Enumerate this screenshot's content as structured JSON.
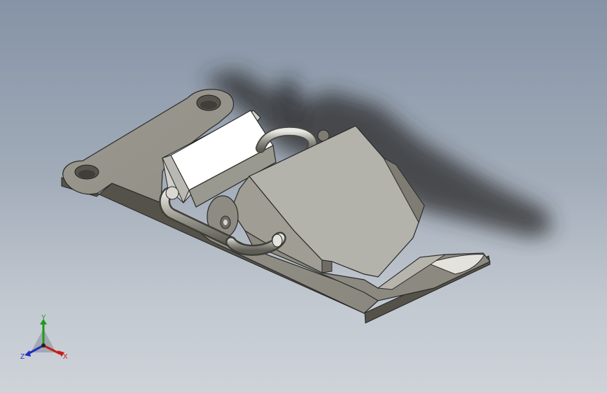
{
  "view": {
    "background_top": "#8593a6",
    "background_bottom": "#ced3d9",
    "part_color": "#8e8c82",
    "highlight_color": "#ffffff"
  },
  "model": {
    "icon": "toggle-latch-3d-model"
  },
  "triad": {
    "y_label": "Y",
    "x_label": "X",
    "z_label": "Z",
    "x_color": "#c81b1b",
    "y_color": "#1d9a1d",
    "z_color": "#1f2fbf"
  }
}
